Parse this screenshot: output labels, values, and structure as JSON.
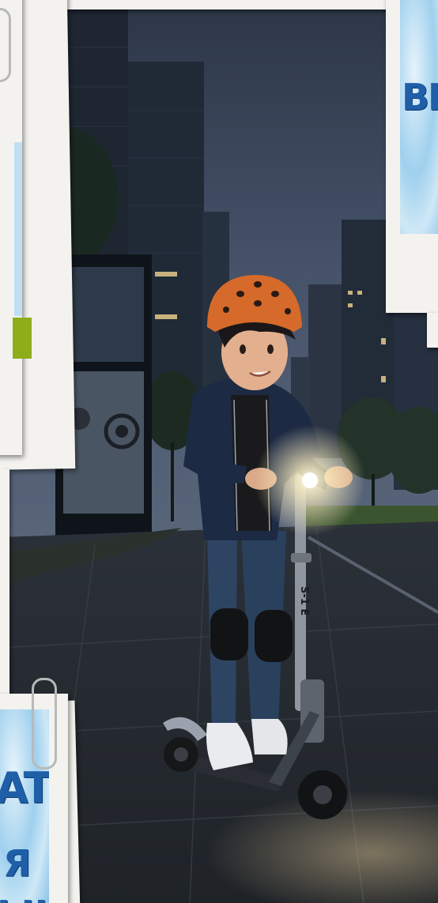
{
  "scene": {
    "description_free": true,
    "scooter_text": "S-1 E"
  },
  "notes": {
    "top_right_text": "BK",
    "bottom_left_line1": "ATE",
    "bottom_left_line2": "Я",
    "bottom_left_line3": "Ы!"
  },
  "colors": {
    "sky": "#3a4658",
    "helmet": "#d66a2a",
    "hoodie": "#1e2a44",
    "jeans": "#2e4766",
    "grass": "#3d5a30",
    "headlight": "#fff6d8",
    "note_accent": "#1f5fa8"
  },
  "icons": [
    "paperclip-icon",
    "paperclip-icon"
  ]
}
